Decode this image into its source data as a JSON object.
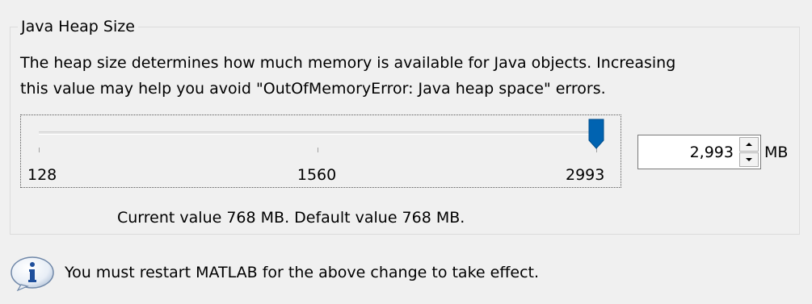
{
  "group": {
    "title": "Java Heap Size",
    "description_line1": "The heap size determines how much memory is available for Java objects. Increasing",
    "description_line2": "this value may help you avoid \"OutOfMemoryError: Java heap space\" errors."
  },
  "slider": {
    "min": 128,
    "max": 2993,
    "value": 2993,
    "ticks": [
      128,
      1560,
      2993
    ],
    "tick_labels": [
      "128",
      "1560",
      "2993"
    ],
    "thumb_color": "#0063b1"
  },
  "spinner": {
    "value": "2,993",
    "unit": "MB"
  },
  "status": {
    "current_default_text": "Current value 768 MB.  Default value 768 MB."
  },
  "info": {
    "icon": "info-icon",
    "message": "You must restart MATLAB for the above change to take effect."
  }
}
